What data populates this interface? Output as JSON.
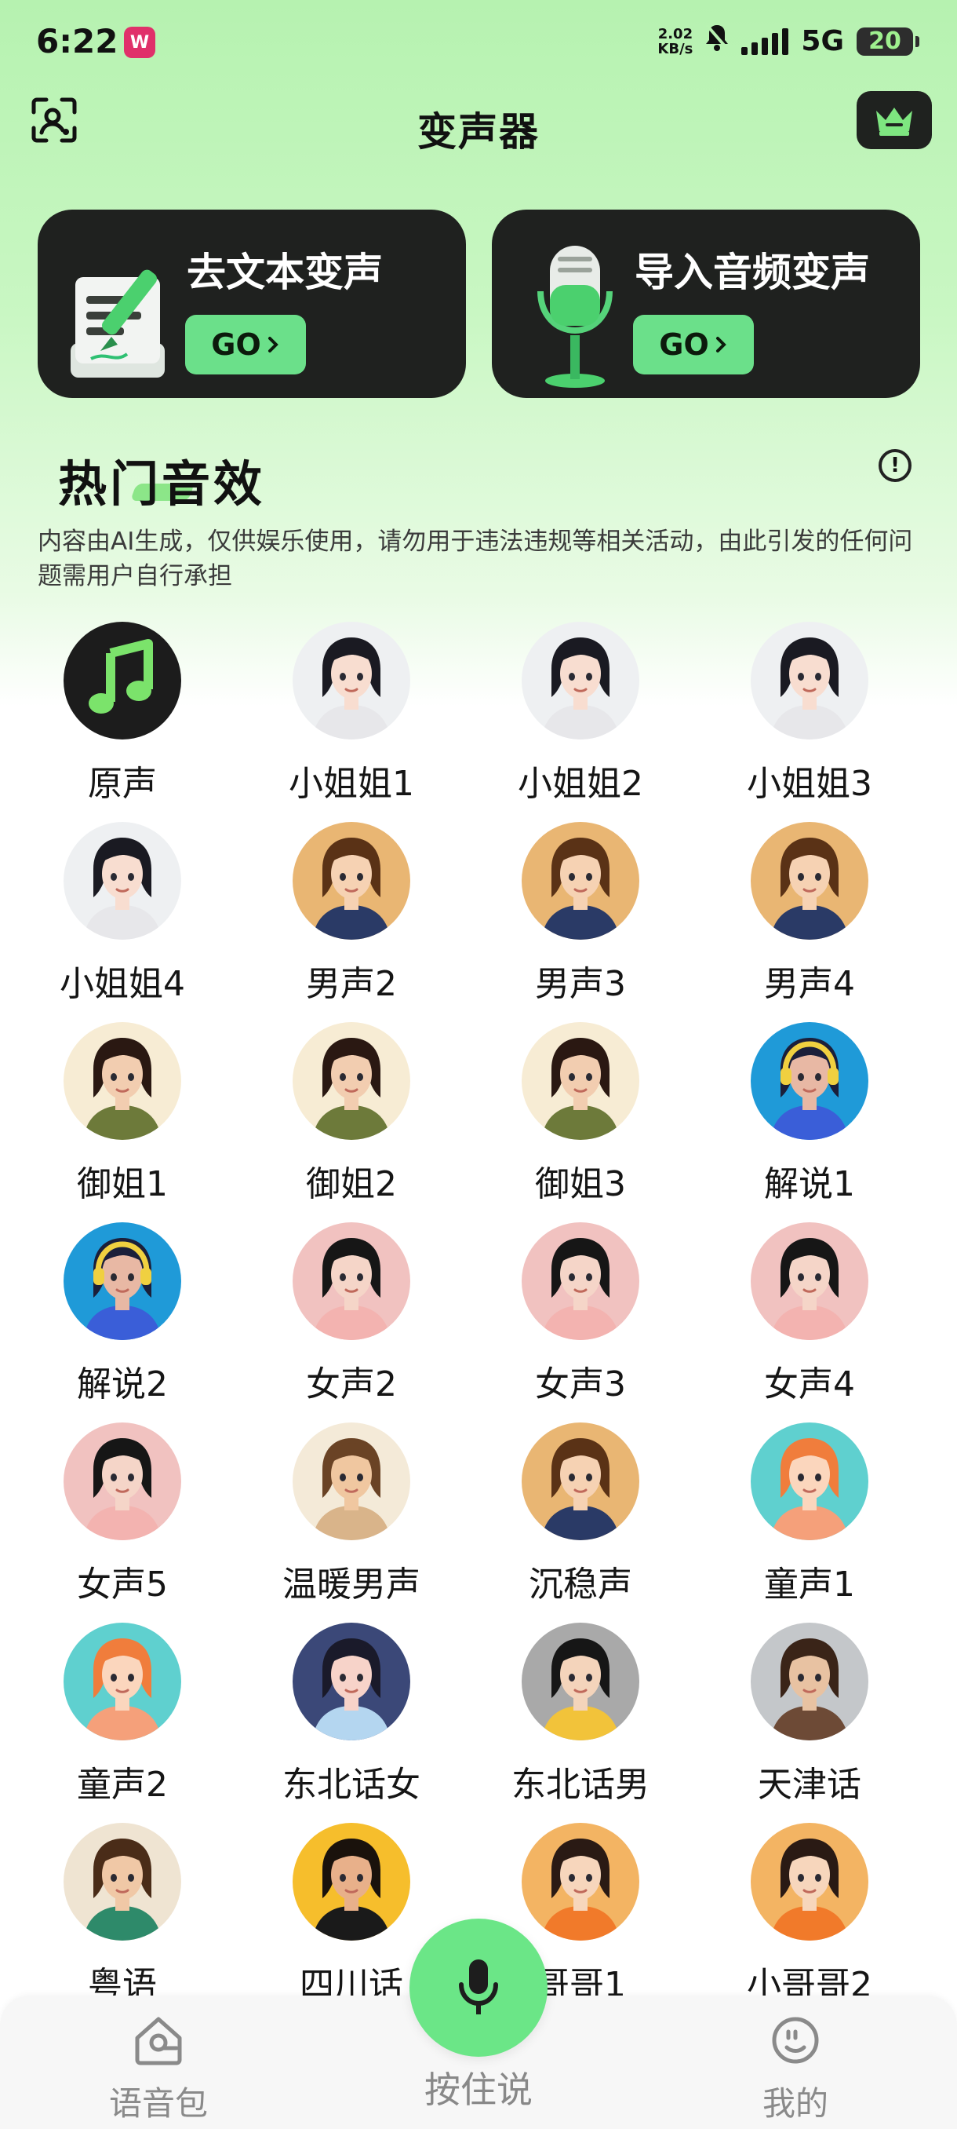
{
  "status_bar": {
    "time": "6:22",
    "net_speed": "2.02",
    "net_unit": "KB/s",
    "network": "5G",
    "battery": "20"
  },
  "header": {
    "title": "变声器",
    "scan_icon": "face-scan-icon",
    "vip_icon": "crown-icon"
  },
  "cards": [
    {
      "title": "去文本变声",
      "go_label": "GO"
    },
    {
      "title": "导入音频变声",
      "go_label": "GO"
    }
  ],
  "hot_section": {
    "title": "热门音效",
    "disclaimer": "内容由AI生成，仅供娱乐使用，请勿用于违法违规等相关活动，由此引发的任何问题需用户自行承担"
  },
  "voices": [
    "原声",
    "小姐姐1",
    "小姐姐2",
    "小姐姐3",
    "小姐姐4",
    "男声2",
    "男声3",
    "男声4",
    "御姐1",
    "御姐2",
    "御姐3",
    "解说1",
    "解说2",
    "女声2",
    "女声3",
    "女声4",
    "女声5",
    "温暖男声",
    "沉稳声",
    "童声1",
    "童声2",
    "东北话女",
    "东北话男",
    "天津话",
    "粤语",
    "四川话",
    "哥哥1",
    "小哥哥2"
  ],
  "bottom_nav": {
    "voice_pack": "语音包",
    "hold_to_talk": "按住说",
    "mine": "我的"
  },
  "colors": {
    "accent": "#6be08a",
    "card_bg": "#1f211f",
    "header_gradient_top": "#b6f2b0"
  }
}
